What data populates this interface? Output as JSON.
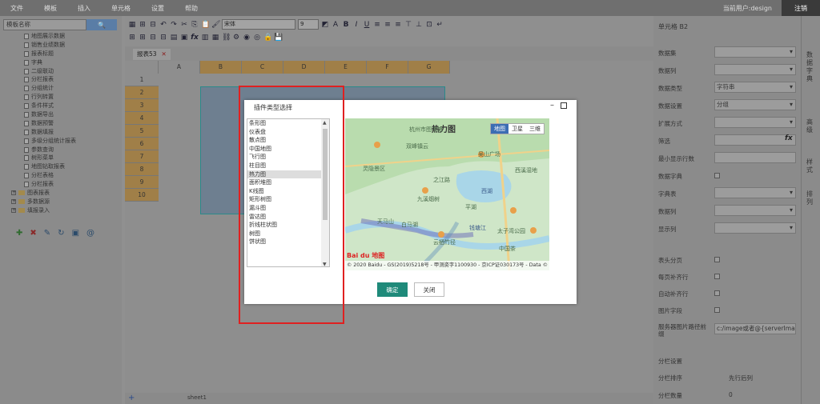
{
  "menubar": {
    "items": [
      "文件",
      "模板",
      "插入",
      "单元格",
      "设置",
      "帮助"
    ],
    "user": "当前用户:design",
    "logout": "注销"
  },
  "leftpanel": {
    "search_placeholder": "模板名称",
    "search_icon": "search-icon",
    "tree": [
      {
        "type": "doc",
        "label": "地图展示数据",
        "indent": 3
      },
      {
        "type": "doc",
        "label": "销售业绩数据",
        "indent": 3
      },
      {
        "type": "doc",
        "label": "报表标题",
        "indent": 3
      },
      {
        "type": "doc",
        "label": "字典",
        "indent": 3
      },
      {
        "type": "doc",
        "label": "二级联动",
        "indent": 3
      },
      {
        "type": "doc",
        "label": "分栏报表",
        "indent": 3
      },
      {
        "type": "doc",
        "label": "分组统计",
        "indent": 3
      },
      {
        "type": "doc",
        "label": "行列转置",
        "indent": 3
      },
      {
        "type": "doc",
        "label": "条件样式",
        "indent": 3
      },
      {
        "type": "doc",
        "label": "数据导出",
        "indent": 3
      },
      {
        "type": "doc",
        "label": "数据预警",
        "indent": 3
      },
      {
        "type": "doc",
        "label": "数据填报",
        "indent": 3
      },
      {
        "type": "doc",
        "label": "多级分组统计报表",
        "indent": 3
      },
      {
        "type": "doc",
        "label": "参数查询",
        "indent": 3
      },
      {
        "type": "doc",
        "label": "树形菜单",
        "indent": 3
      },
      {
        "type": "doc",
        "label": "地图钻取报表",
        "indent": 3
      },
      {
        "type": "doc",
        "label": "分栏表格",
        "indent": 3
      },
      {
        "type": "doc",
        "label": "分栏报表",
        "indent": 3
      },
      {
        "type": "folder",
        "label": "图表报表",
        "indent": 1
      },
      {
        "type": "folder",
        "label": "多数据源",
        "indent": 1
      },
      {
        "type": "folder",
        "label": "填报录入",
        "indent": 1
      }
    ],
    "icons": [
      "add-icon",
      "delete-icon",
      "edit-icon",
      "refresh-icon",
      "preview-icon",
      "at-icon"
    ]
  },
  "toolbar": {
    "font": "宋体",
    "size": "9"
  },
  "sheet": {
    "tab": "报表53",
    "name": "sheet1",
    "columns": [
      "A",
      "B",
      "C",
      "D",
      "E",
      "F",
      "G"
    ],
    "rows": [
      "1",
      "2",
      "3",
      "4",
      "5",
      "6",
      "7",
      "8",
      "9",
      "10"
    ]
  },
  "rightpanel": {
    "title": "单元格 B2",
    "props": [
      {
        "label": "数据集",
        "value": "",
        "type": "dd"
      },
      {
        "label": "数据列",
        "value": "",
        "type": "dd"
      },
      {
        "label": "数据类型",
        "value": "字符串",
        "type": "dd"
      },
      {
        "label": "数据设置",
        "value": "分组",
        "type": "dd"
      },
      {
        "label": "扩展方式",
        "value": "",
        "type": "dd"
      },
      {
        "label": "筛选",
        "value": "",
        "type": "fx"
      },
      {
        "label": "最小显示行数",
        "value": "",
        "type": "text"
      },
      {
        "label": "数据字典",
        "value": "",
        "type": "cb"
      },
      {
        "label": "字典表",
        "value": "",
        "type": "dd"
      },
      {
        "label": "数据列",
        "value": "",
        "type": "dd"
      },
      {
        "label": "显示列",
        "value": "",
        "type": "dd"
      }
    ],
    "props2": [
      {
        "label": "表头分页",
        "type": "cb"
      },
      {
        "label": "每页补齐行",
        "type": "cb"
      },
      {
        "label": "自动补齐行",
        "type": "cb"
      },
      {
        "label": "图片字段",
        "type": "cb"
      },
      {
        "label": "服务器图片路径前缀",
        "value": "c:/image或者@{serverImage",
        "type": "text"
      }
    ],
    "section": "分栏设置",
    "footer1": "分栏排序",
    "footer1_val": "先行后列",
    "footer2": "分栏数量",
    "footer2_val": "0",
    "sidetabs": [
      "数据字典",
      "高级",
      "样式",
      "排列"
    ]
  },
  "modal": {
    "title": "插件类型选择",
    "items": [
      "条形图",
      "仪表盘",
      "散点图",
      "中国地图",
      "飞行图",
      "柱目图",
      "热力图",
      "面积堆图",
      "K线图",
      "矩形树图",
      "漏斗图",
      "雷达图",
      "折线柱状图",
      "树图",
      "饼状图"
    ],
    "selected_index": 6,
    "map": {
      "heat_title": "热力图",
      "tabs": [
        "地图",
        "卫星",
        "三维"
      ],
      "labels": [
        "杭州市图书馆",
        "双峰镇云",
        "灵隐景区",
        "西湖",
        "吴山广场",
        "西溪湿地",
        "天马山",
        "中国茶",
        "白马湖",
        "钱塘江",
        "九溪烟树",
        "平湖",
        "太子湾公园",
        "云栖竹径",
        "之江路"
      ],
      "copyright": "© 2020 Baidu - GS(2019)5218号 - 甲测资字1100930 - 京ICP证030173号 - Data ©",
      "logo": "Bai du 地图"
    },
    "ok": "确定",
    "close": "关闭"
  }
}
